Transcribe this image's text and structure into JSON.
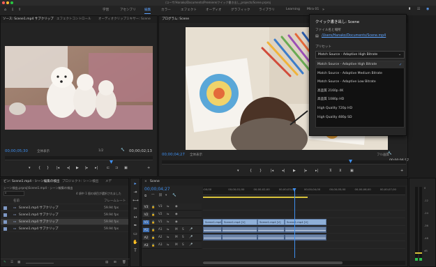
{
  "window": {
    "title": "/ユーザ/Hanako/Documents/Premiere/クイック書き出し_projects/Scene.prproj"
  },
  "menubar": {
    "workspaces": [
      "学習",
      "アセンブリ",
      "編集",
      "カラー",
      "エフェクト",
      "オーディオ",
      "グラフィック",
      "ライブラリ",
      "Learning",
      "Mira 01"
    ],
    "active": "編集"
  },
  "source_panel": {
    "tabs": [
      "ソース: Scene1.mp4 サブクリップ",
      "エフェクトコントロール",
      "オーディオクリップミキサー: Scene"
    ],
    "timecode_left": "00;00;05;30",
    "fit": "全体表示",
    "scale": "1/2",
    "timecode_right": "00;00;02;13"
  },
  "program_panel": {
    "title": "プログラム: Scene",
    "timecode_left": "00;00;04;27",
    "fit": "全体表示",
    "quality": "フル画質",
    "timecode_right": "00;00;06;17"
  },
  "export_popup": {
    "title": "クイック書き出し: Scene",
    "file_label": "ファイル名と場所",
    "file_path": "/Users/Hanako/Documents/Scene.mp4",
    "preset_label": "プリセット",
    "selected": "Match Source - Adaptive High Bitrate",
    "options": [
      "Match Source - Adaptive High Bitrate",
      "Match Source - Adaptive Medium Bitrate",
      "Match Source - Adaptive Low Bitrate",
      "高品質 2160p 4K",
      "高品質 1080p HD",
      "High Quality 720p HD",
      "High Quality 480p SD"
    ]
  },
  "project_panel": {
    "tabs": [
      "ビン: Scene1.mp4 - シーン編集の検出",
      "プロジェクト: シーン検出",
      "メデ"
    ],
    "path": "シーン検出.prproj\\Scene1.mp4 - シーン編集の検出",
    "selection_info": "4 項中 1 個の項目が選択されました",
    "col_name": "名前",
    "col_fps": "フレームレート",
    "items": [
      {
        "name": "Scene1.mp4 サブクリップ",
        "fps": "59.94 fps"
      },
      {
        "name": "Scene1.mp4 サブクリップ",
        "fps": "59.94 fps"
      },
      {
        "name": "Scene1.mp4 サブクリップ",
        "fps": "59.94 fps"
      },
      {
        "name": "Scene1.mp4 サブクリップ",
        "fps": "59.94 fps"
      }
    ]
  },
  "timeline": {
    "tab": "Scene",
    "timecode": "00;00;04;27",
    "ticks": [
      ":00;00",
      "00;00;01;00",
      "00;00;02;00",
      "00;00;03;00",
      "00;00;04;00",
      "00;00;05;00",
      "00;00;06;00",
      "00;00;07;00"
    ],
    "video_tracks": [
      "V3",
      "V2",
      "V1"
    ],
    "audio_tracks": [
      "A1",
      "A2",
      "A3"
    ],
    "clips": [
      "Scene1.mp4 [V]",
      "Scene1.mp4 [V]",
      "Scene1.mp4 [V]",
      "Scene1.mp4 [V]"
    ],
    "playhead_fraction": 0.45
  },
  "audio_meter": {
    "labels": [
      "0",
      "-12",
      "-24",
      "-36",
      "-48",
      "dB"
    ]
  },
  "colors": {
    "accent": "#3e8ff0",
    "video_clip": "#8fb0d8",
    "audio_clip": "#6c84a8"
  }
}
